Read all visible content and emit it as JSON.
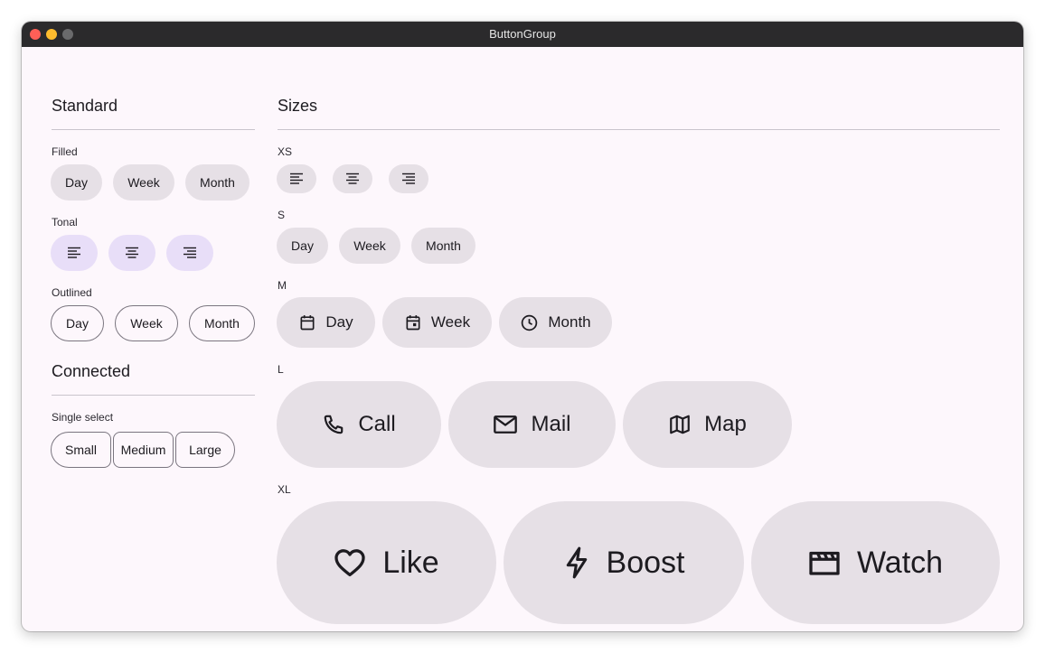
{
  "window": {
    "title": "ButtonGroup"
  },
  "standard": {
    "heading": "Standard",
    "filled": {
      "label": "Filled",
      "buttons": [
        "Day",
        "Week",
        "Month"
      ]
    },
    "tonal": {
      "label": "Tonal",
      "icons": [
        "format-align-left-icon",
        "format-align-center-icon",
        "format-align-right-icon"
      ]
    },
    "outlined": {
      "label": "Outlined",
      "buttons": [
        "Day",
        "Week",
        "Month"
      ]
    }
  },
  "connected": {
    "heading": "Connected",
    "single_select": {
      "label": "Single select",
      "buttons": [
        "Small",
        "Medium",
        "Large"
      ]
    }
  },
  "sizes": {
    "heading": "Sizes",
    "xs": {
      "label": "XS",
      "icons": [
        "format-align-left-icon",
        "format-align-center-icon",
        "format-align-right-icon"
      ]
    },
    "s": {
      "label": "S",
      "buttons": [
        "Day",
        "Week",
        "Month"
      ]
    },
    "m": {
      "label": "M",
      "buttons": [
        {
          "label": "Day",
          "icon": "calendar-icon"
        },
        {
          "label": "Week",
          "icon": "calendar-week-icon"
        },
        {
          "label": "Month",
          "icon": "clock-icon"
        }
      ]
    },
    "l": {
      "label": "L",
      "buttons": [
        {
          "label": "Call",
          "icon": "phone-icon"
        },
        {
          "label": "Mail",
          "icon": "mail-icon"
        },
        {
          "label": "Map",
          "icon": "map-icon"
        }
      ]
    },
    "xl": {
      "label": "XL",
      "buttons": [
        {
          "label": "Like",
          "icon": "heart-icon"
        },
        {
          "label": "Boost",
          "icon": "bolt-icon"
        },
        {
          "label": "Watch",
          "icon": "movie-icon"
        }
      ]
    }
  },
  "colors": {
    "window_bg": "#fdf7fc",
    "filled_bg": "#e6e0e6",
    "tonal_bg": "#e8def8",
    "outline": "#7a757f",
    "text": "#1d1b20"
  }
}
